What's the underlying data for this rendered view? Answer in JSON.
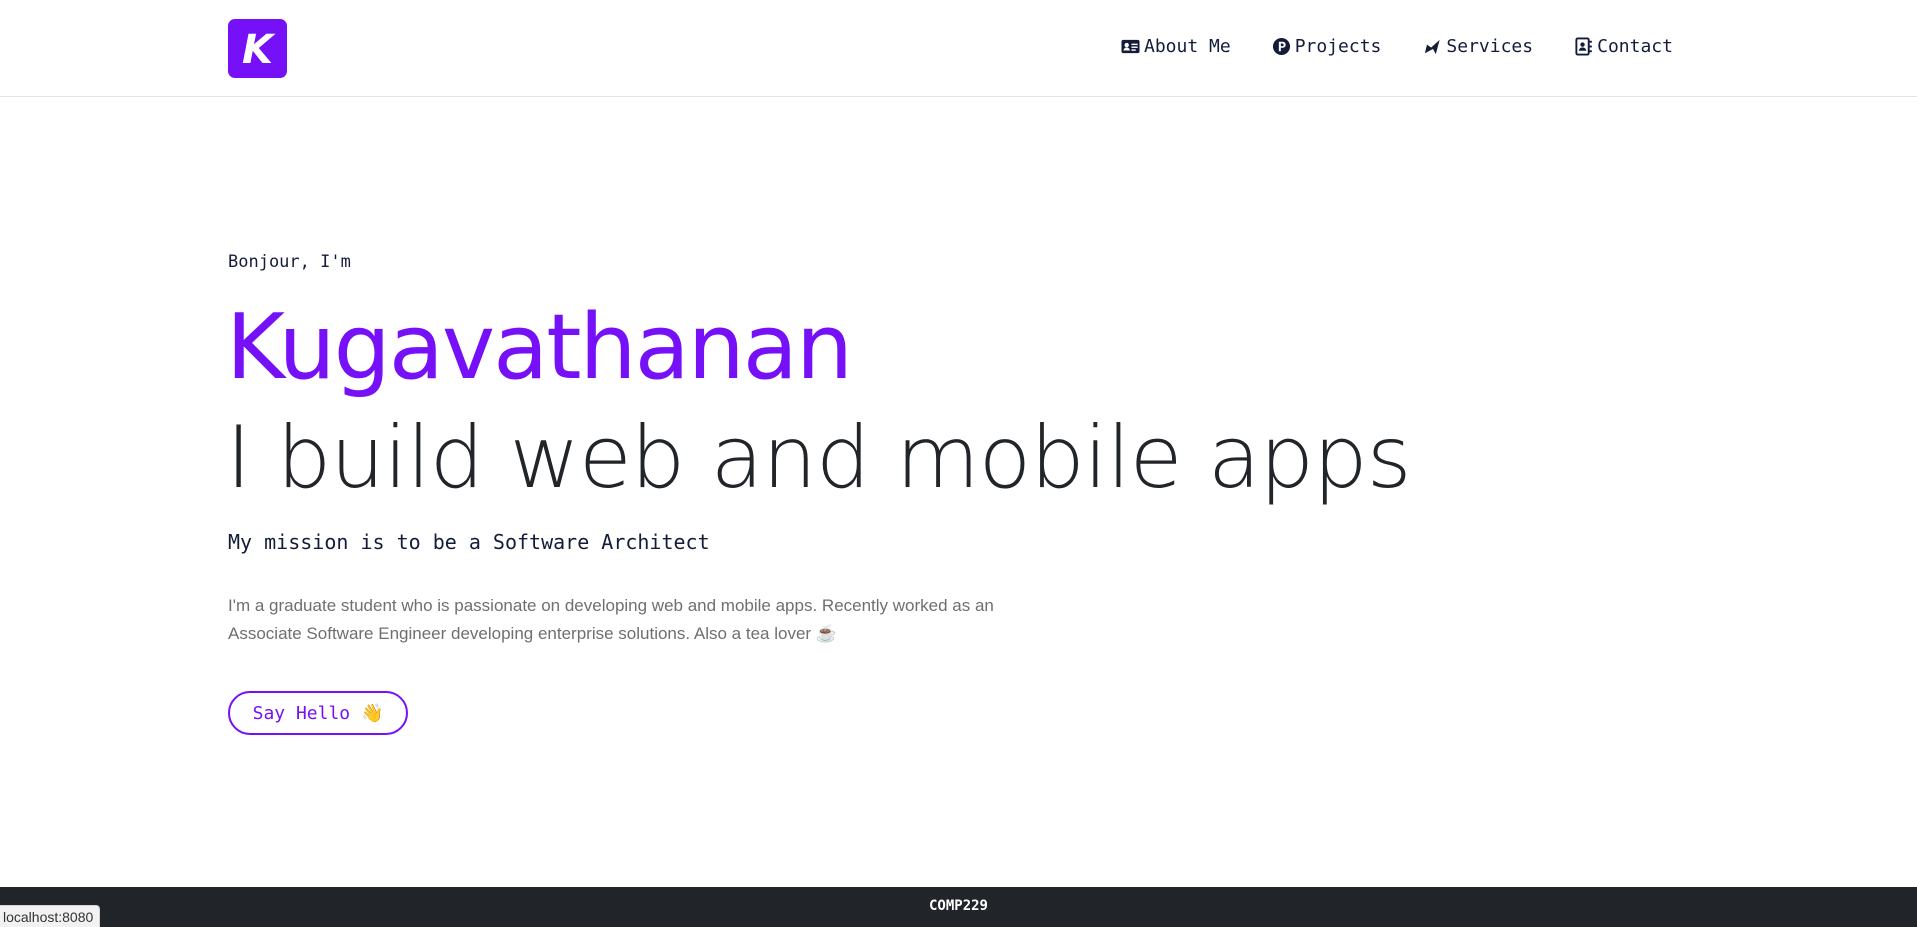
{
  "brand": {
    "logo_letter": "K",
    "accent_color": "#7510f7"
  },
  "nav": {
    "items": [
      {
        "label": "About Me",
        "icon": "id-card-icon"
      },
      {
        "label": "Projects",
        "icon": "parking-p-icon"
      },
      {
        "label": "Services",
        "icon": "paper-plane-icon"
      },
      {
        "label": "Contact",
        "icon": "address-book-icon"
      }
    ]
  },
  "hero": {
    "greeting": "Bonjour, I'm",
    "name": "Kugavathanan",
    "tagline": "I build web and mobile apps",
    "mission": "My mission is to be a Software Architect",
    "description": "I'm a graduate student who is passionate on developing web and mobile apps. Recently worked as an Associate Software Engineer developing enterprise solutions. Also a tea lover ☕",
    "cta_label": "Say Hello 👋"
  },
  "footer": {
    "text": "COMP229",
    "background": "#212529"
  },
  "status_bar": {
    "url": "localhost:8080"
  }
}
